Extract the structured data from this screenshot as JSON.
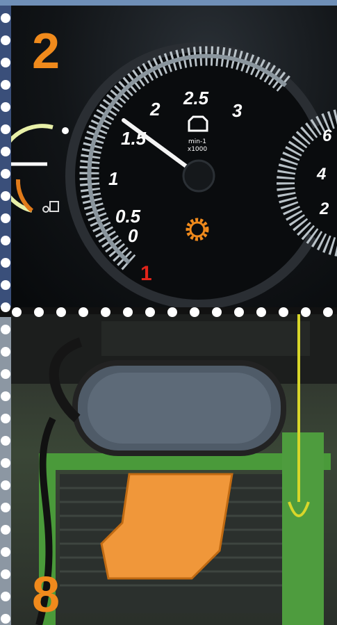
{
  "panel_top": {
    "number": "2",
    "gauge": {
      "scale_labels": [
        "0",
        "0.5",
        "1",
        "1.5",
        "2",
        "2.5",
        "3"
      ],
      "unit_line1": "min-1",
      "unit_line2": "x1000",
      "gear_indicator": "1",
      "needle_value": 1.4
    },
    "right_gauge_labels": [
      "2",
      "4",
      "6"
    ],
    "warning_icon": "engine-warning-icon",
    "indicator_icon": "glow-plug-icon"
  },
  "panel_bottom": {
    "number": "8"
  },
  "colors": {
    "accent_orange": "#f08a1c",
    "frame_blue": "#3a4f7a",
    "perforation": "#ffffff",
    "tractor_green": "#4a9a3a"
  }
}
